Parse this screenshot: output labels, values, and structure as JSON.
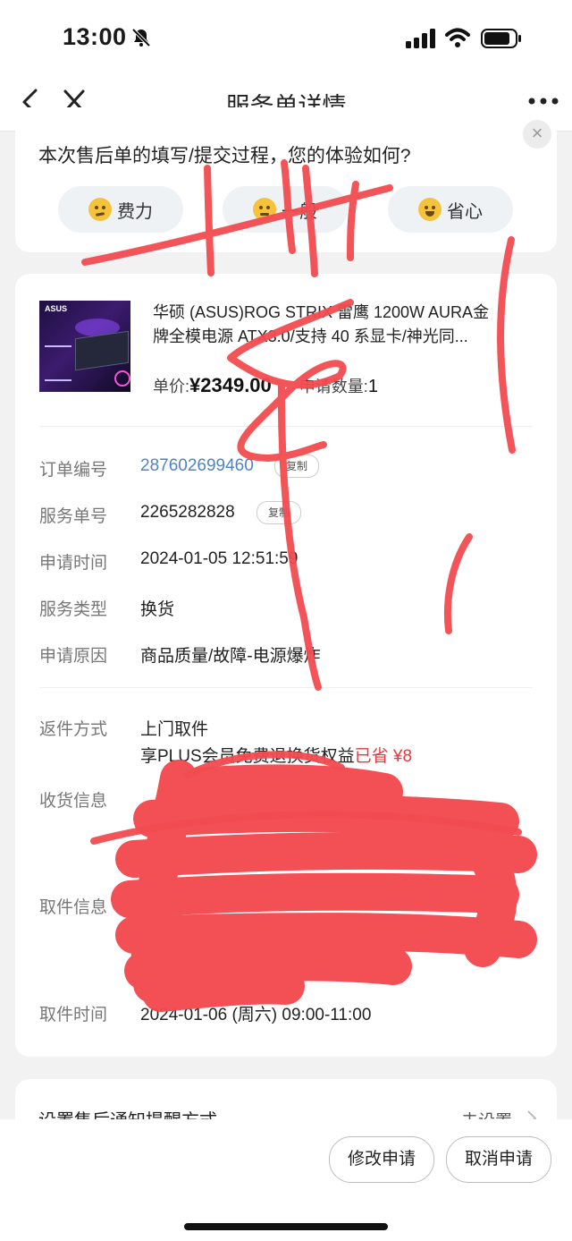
{
  "status": {
    "time": "13:00"
  },
  "nav": {
    "title": "服务单详情"
  },
  "survey": {
    "question": "本次售后单的填写/提交过程，您的体验如何?",
    "options": [
      {
        "label": "费力"
      },
      {
        "label": "一般"
      },
      {
        "label": "省心"
      }
    ],
    "close": "×"
  },
  "product": {
    "name": "华硕 (ASUS)ROG STRIX 雷鹰 1200W AURA金牌全模电源 ATX3.0/支持 40 系显卡/神光同...",
    "image_logo": "ASUS",
    "price_label": "单价:",
    "price": "¥2349.00",
    "qty_label": "申请数量:",
    "qty": "1"
  },
  "details": {
    "order_no_label": "订单编号",
    "order_no": "287602699460",
    "copy_label": "复制",
    "service_no_label": "服务单号",
    "service_no": "2265282828",
    "apply_time_label": "申请时间",
    "apply_time": "2024-01-05 12:51:59",
    "service_type_label": "服务类型",
    "service_type": "换货",
    "reason_label": "申请原因",
    "reason": "商品质量/故障-电源爆炸",
    "return_label": "返件方式",
    "return_method": "上门取件",
    "plus_text": "享PLUS会员免费退换货权益",
    "saved_text": "已省 ¥8",
    "receive_label": "收货信息",
    "pickup_info_label": "取件信息",
    "pickup_time_label": "取件时间",
    "pickup_time": "2024-01-06 (周六) 09:00-11:00"
  },
  "notify": {
    "label": "设置售后通知提醒方式",
    "value": "去设置"
  },
  "actions": {
    "modify": "修改申请",
    "cancel": "取消申请"
  },
  "colors": {
    "link": "#4f84c4",
    "saved": "#e4393c",
    "scribble": "#f24b50"
  }
}
